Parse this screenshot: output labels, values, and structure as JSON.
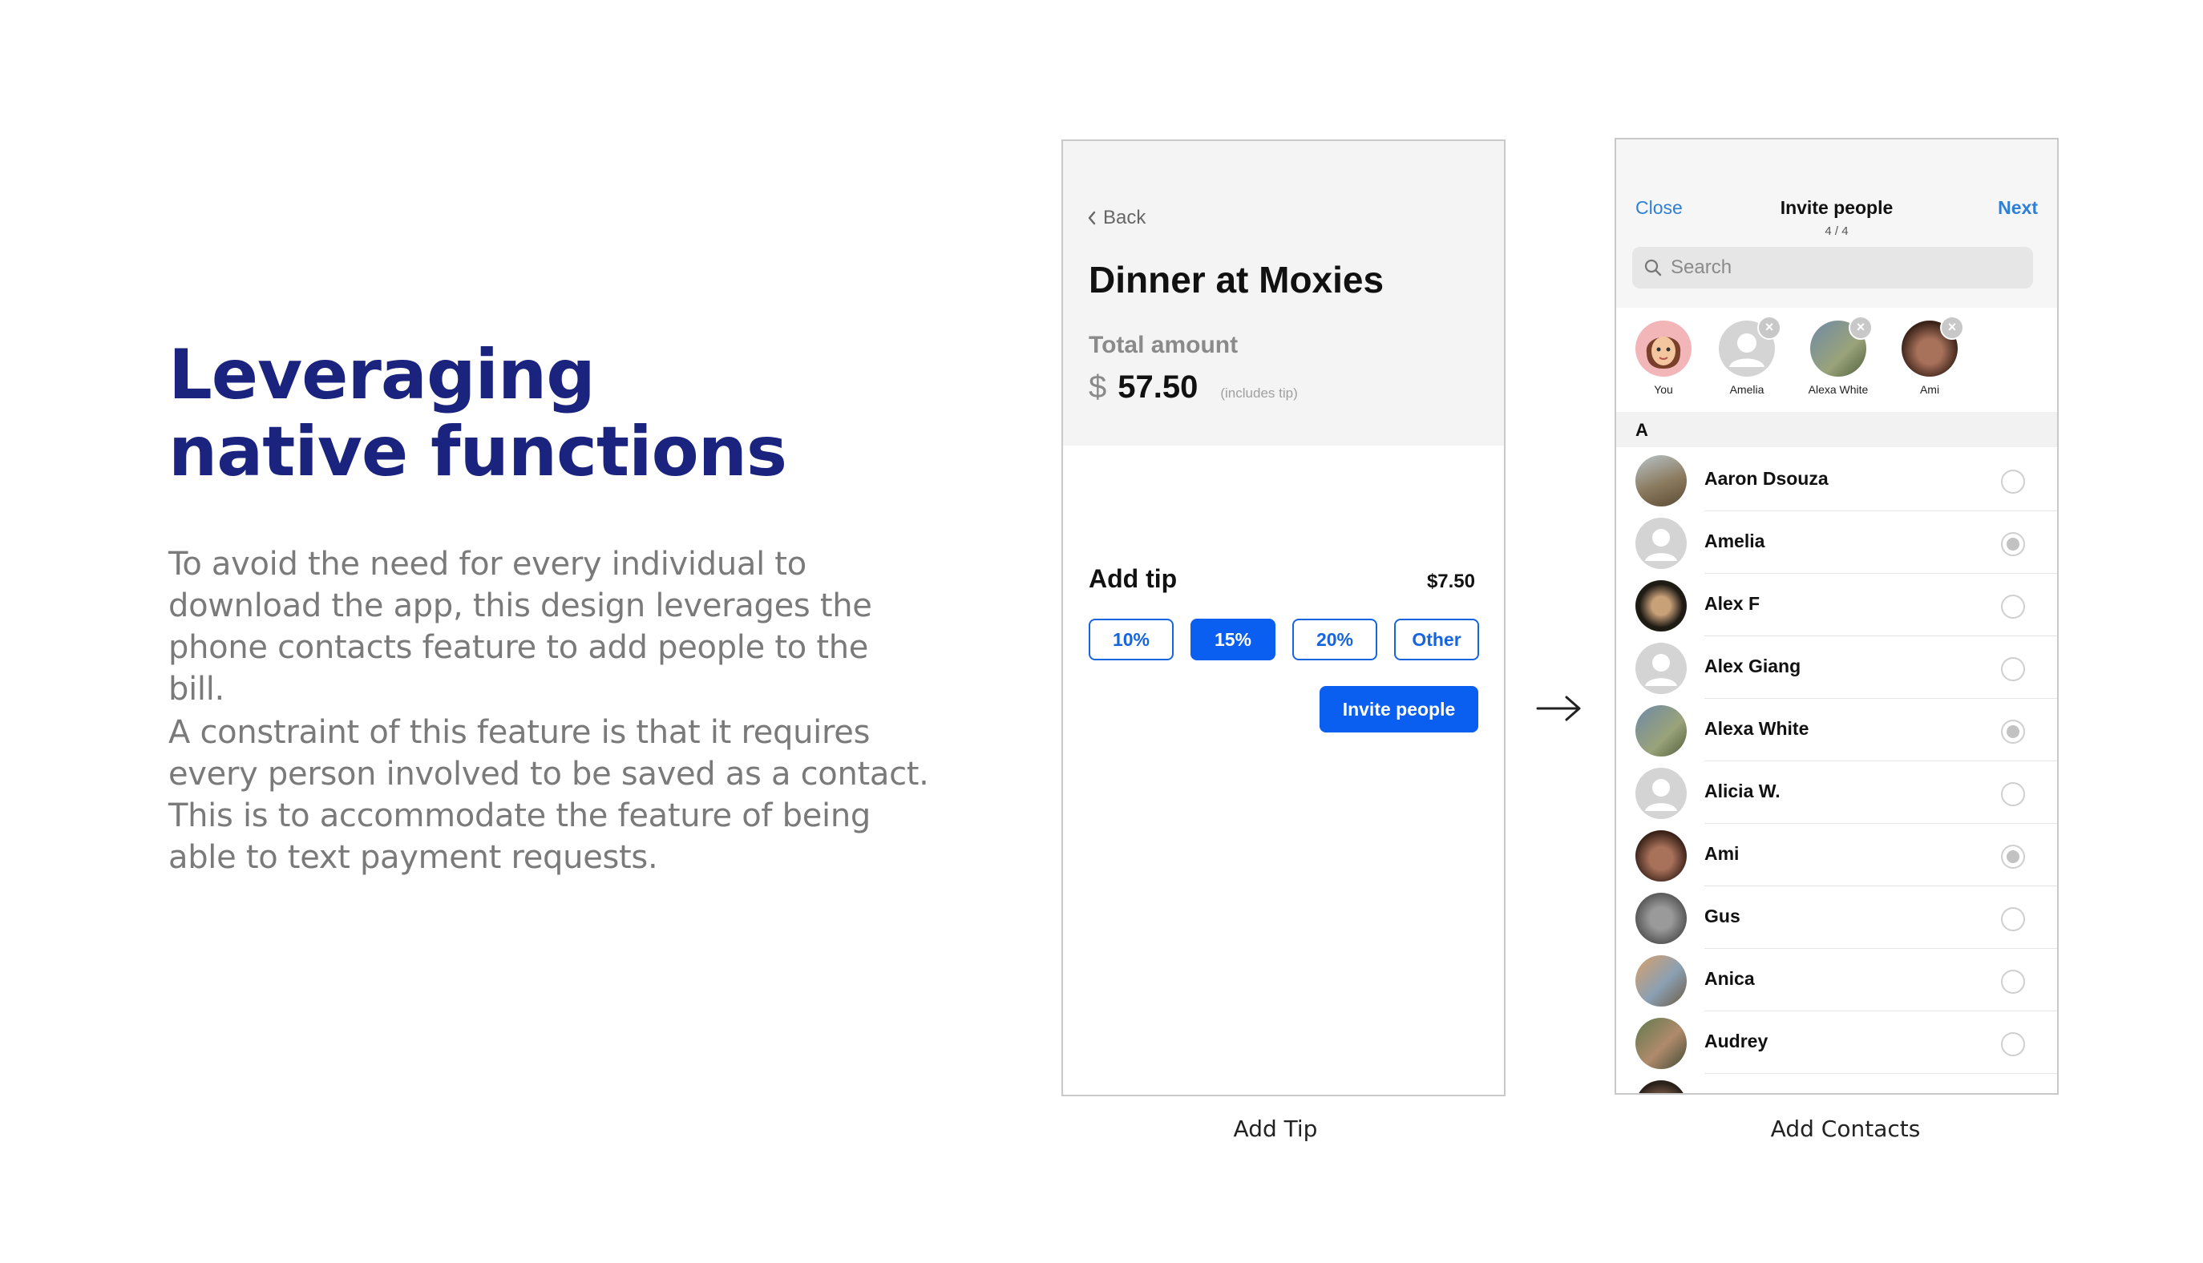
{
  "slide": {
    "headline_line1": "Leveraging",
    "headline_line2": "native functions",
    "paragraph1": "To avoid the need for every individual to download the app, this design leverages the phone contacts feature to add people to the bill.",
    "paragraph2": "A constraint of this feature is that it requires every person involved to be saved as a contact. This is to accommodate the feature of being able to text payment requests."
  },
  "add_tip_screen": {
    "back_label": "Back",
    "title": "Dinner at Moxies",
    "total_label": "Total amount",
    "currency": "$",
    "amount": "57.50",
    "amount_note": "(includes tip)",
    "tip_label": "Add tip",
    "tip_value": "$7.50",
    "tip_options": [
      "10%",
      "15%",
      "20%",
      "Other"
    ],
    "selected_tip": "15%",
    "invite_button": "Invite people",
    "caption": "Add Tip"
  },
  "contacts_screen": {
    "close_label": "Close",
    "title": "Invite people",
    "count": "4 / 4",
    "next_label": "Next",
    "search_placeholder": "Search",
    "selected": [
      {
        "name": "You",
        "removable": false
      },
      {
        "name": "Amelia",
        "removable": true
      },
      {
        "name": "Alexa White",
        "removable": true
      },
      {
        "name": "Ami",
        "removable": true
      }
    ],
    "section_letter": "A",
    "contacts": [
      {
        "name": "Aaron Dsouza",
        "checked": false
      },
      {
        "name": "Amelia",
        "checked": true
      },
      {
        "name": "Alex F",
        "checked": false
      },
      {
        "name": "Alex Giang",
        "checked": false
      },
      {
        "name": "Alexa White",
        "checked": true
      },
      {
        "name": "Alicia W.",
        "checked": false
      },
      {
        "name": "Ami",
        "checked": true
      },
      {
        "name": "Gus",
        "checked": false
      },
      {
        "name": "Anica",
        "checked": false
      },
      {
        "name": "Audrey",
        "checked": false
      }
    ],
    "caption": "Add Contacts"
  },
  "colors": {
    "headline": "#1a237e",
    "primary_blue": "#0a5ef0",
    "link_blue": "#2f7fd6"
  },
  "icons": [
    "chevron-left-icon",
    "arrow-right-icon",
    "search-icon",
    "remove-icon",
    "avatar-placeholder-icon"
  ]
}
